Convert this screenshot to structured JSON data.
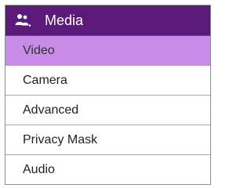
{
  "menu": {
    "header": {
      "title": "Media",
      "icon": "users-icon"
    },
    "items": [
      {
        "label": "Video",
        "active": true
      },
      {
        "label": "Camera",
        "active": false
      },
      {
        "label": "Advanced",
        "active": false
      },
      {
        "label": "Privacy Mask",
        "active": false
      },
      {
        "label": "Audio",
        "active": false
      }
    ]
  },
  "colors": {
    "header_bg": "#5b1a7a",
    "active_bg": "#c98be8"
  }
}
